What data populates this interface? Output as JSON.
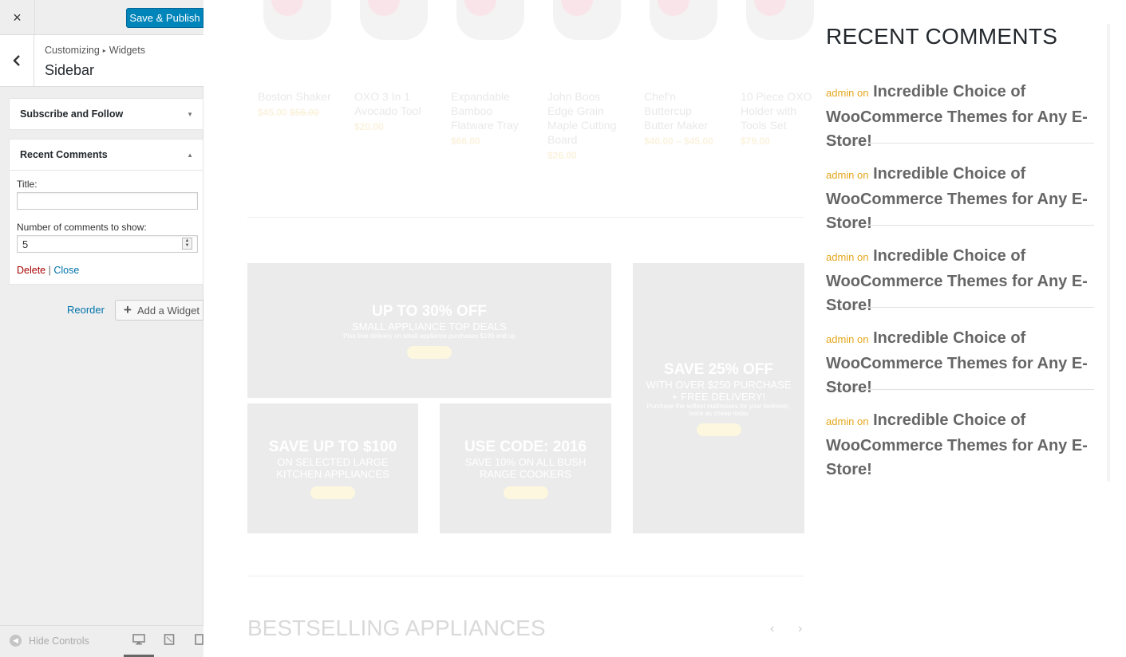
{
  "header": {
    "close_icon": "×",
    "publish_label": "Save & Publish"
  },
  "breadcrumb": {
    "path_root": "Customizing",
    "path_leaf": "Widgets",
    "title": "Sidebar"
  },
  "widgets": {
    "subscribe": {
      "label": "Subscribe and Follow"
    },
    "recent": {
      "label": "Recent Comments",
      "title_label": "Title:",
      "title_value": "",
      "count_label": "Number of comments to show:",
      "count_value": "5",
      "delete_label": "Delete",
      "separator": "|",
      "close_label": "Close"
    }
  },
  "actions": {
    "reorder_label": "Reorder",
    "add_widget_label": "Add a Widget"
  },
  "footer": {
    "hide_controls_label": "Hide Controls",
    "devices": [
      "desktop-icon",
      "tablet-icon",
      "mobile-icon"
    ]
  },
  "products": [
    {
      "name": "Boston Shaker",
      "price": "$45.00",
      "old_price": "$56.00"
    },
    {
      "name": "OXO 3 In 1 Avocado Tool",
      "price": "$20.00",
      "old_price": ""
    },
    {
      "name": "Expandable Bamboo Flatware Tray",
      "price": "$66.00",
      "old_price": ""
    },
    {
      "name": "John Boos Edge Grain Maple Cutting Board",
      "price": "$26.00",
      "old_price": ""
    },
    {
      "name": "Chef'n Buttercup Butter Maker",
      "price": "$40.00 – $45.00",
      "old_price": ""
    },
    {
      "name": "10 Piece OXO Holder with Tools Set",
      "price": "$79.00",
      "old_price": ""
    }
  ],
  "banners": [
    {
      "headline": "UP TO 30% OFF",
      "sub": "SMALL APPLIANCE TOP DEALS",
      "small": "Plus free delivery on small appliance purchases $199 and up"
    },
    {
      "headline": "SAVE 25% OFF",
      "sub": "WITH OVER $250 PURCHASE + FREE DELIVERY!",
      "small": "Purchase the softest mattresses for your bedroom, twice as cheap today"
    },
    {
      "headline": "SAVE UP TO $100",
      "sub": "ON SELECTED LARGE KITCHEN APPLIANCES",
      "small": ""
    },
    {
      "headline": "USE CODE: 2016",
      "sub": "SAVE 10% ON ALL BUSH RANGE COOKERS",
      "small": ""
    }
  ],
  "bestselling_title": "BESTSELLING APPLIANCES",
  "recent_comments": {
    "title": "RECENT COMMENTS",
    "items": [
      {
        "author": "admin",
        "on": "on",
        "post": "Incredible Choice of WooCommerce Themes for Any E-Store!"
      },
      {
        "author": "admin",
        "on": "on",
        "post": "Incredible Choice of WooCommerce Themes for Any E-Store!"
      },
      {
        "author": "admin",
        "on": "on",
        "post": "Incredible Choice of WooCommerce Themes for Any E-Store!"
      },
      {
        "author": "admin",
        "on": "on",
        "post": "Incredible Choice of WooCommerce Themes for Any E-Store!"
      },
      {
        "author": "admin",
        "on": "on",
        "post": "Incredible Choice of WooCommerce Themes for Any E-Store!"
      }
    ]
  },
  "colors": {
    "accent": "#0085ba",
    "link": "#0073aa",
    "delete": "#aa0000",
    "meta": "#e4a71d"
  }
}
